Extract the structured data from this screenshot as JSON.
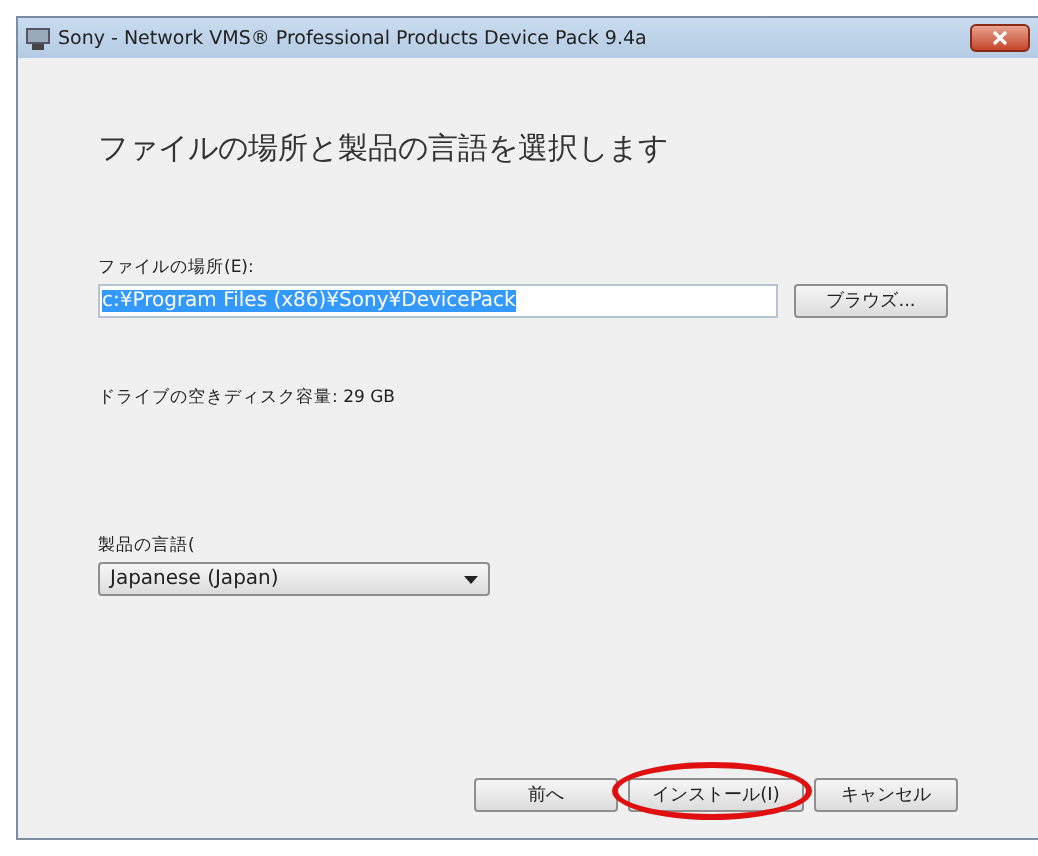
{
  "window": {
    "title": "Sony - Network VMS® Professional Products Device Pack 9.4a"
  },
  "heading": "ファイルの場所と製品の言語を選択します",
  "location": {
    "label": "ファイルの場所(E):",
    "value": "c:¥Program Files (x86)¥Sony¥DevicePack",
    "browse_button": "ブラウズ..."
  },
  "disk_space": "ドライブの空きディスク容量: 29 GB",
  "language": {
    "label": "製品の言語(",
    "value": "Japanese (Japan)"
  },
  "buttons": [
    {
      "label": "前へ",
      "highlighted": false
    },
    {
      "label": "インストール(I)",
      "highlighted": true
    },
    {
      "label": "キャンセル",
      "highlighted": false
    }
  ]
}
